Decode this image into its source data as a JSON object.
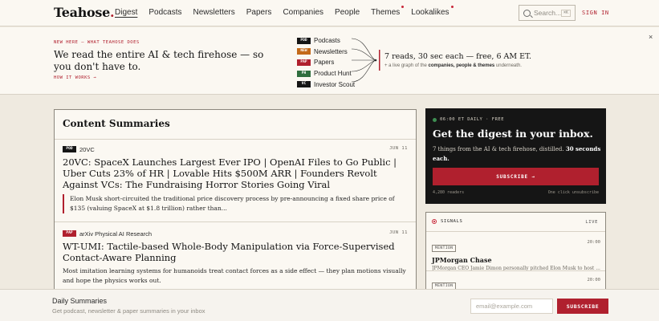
{
  "nav": {
    "logo": "Teahose",
    "logo_dot": ".",
    "links": [
      {
        "label": "Digest",
        "active": true,
        "dot": false
      },
      {
        "label": "Podcasts",
        "active": false,
        "dot": false
      },
      {
        "label": "Newsletters",
        "active": false,
        "dot": false
      },
      {
        "label": "Papers",
        "active": false,
        "dot": false
      },
      {
        "label": "Companies",
        "active": false,
        "dot": false
      },
      {
        "label": "People",
        "active": false,
        "dot": false
      },
      {
        "label": "Themes",
        "active": false,
        "dot": true
      },
      {
        "label": "Lookalikes",
        "active": false,
        "dot": true
      }
    ],
    "search_placeholder": "Search...",
    "search_shortcut": "⌘K",
    "signin": "SIGN IN"
  },
  "banner": {
    "kicker": "NEW HERE — WHAT TEAHOSE DOES",
    "headline": "We read the entire AI & tech firehose — so you don't have to.",
    "how_link": "HOW IT WORKS →",
    "sources": [
      {
        "badge": "POD",
        "label": "Podcasts",
        "color": "#151515"
      },
      {
        "badge": "NEW",
        "label": "Newsletters",
        "color": "#c46a1a"
      },
      {
        "badge": "PAP",
        "label": "Papers",
        "color": "#b0202e"
      },
      {
        "badge": "PH",
        "label": "Product Hunt",
        "color": "#2f6e3e"
      },
      {
        "badge": "VC",
        "label": "Investor Scout",
        "color": "#151515"
      }
    ],
    "tagline": "7 reads, 30 sec each — free, 6 AM ET.",
    "sub_prefix": "+ a live graph of the ",
    "sub_bold": "companies, people & themes",
    "sub_suffix": " underneath.",
    "close": "×"
  },
  "summaries": {
    "title": "Content Summaries",
    "items": [
      {
        "badge": "POD",
        "badge_color": "#151515",
        "source": "20VC",
        "date": "JUN 11",
        "title": "20VC: SpaceX Launches Largest Ever IPO | OpenAI Files to Go Public | Uber Cuts 23% of HR | Lovable Hits $500M ARR | Founders Revolt Against VCs: The Fundraising Horror Stories Going Viral",
        "quote": "Elon Musk short-circuited the traditional price discovery process by pre-announcing a fixed share price of $135 (valuing SpaceX at $1.8 trillion) rather than..."
      },
      {
        "badge": "PAP",
        "badge_color": "#b0202e",
        "source": "arXiv Physical AI Research",
        "date": "JUN 11",
        "title": "WT-UMI: Tactile-based Whole-Body Manipulation via Force-Supervised Contact-Aware Planning",
        "excerpt": "Most imitation learning systems for humanoids treat contact forces as a side effect — they plan motions visually and hope the physics works out."
      }
    ]
  },
  "digest": {
    "kicker": "06:00 ET DAILY · FREE",
    "title": "Get the digest in your inbox.",
    "body_prefix": "7 things from the AI & tech firehose, distilled. ",
    "body_bold": "30 seconds each.",
    "button": "SUBSCRIBE →",
    "readers": "4,280 readers",
    "unsub": "One click unsubscribe"
  },
  "signals": {
    "title": "SIGNALS",
    "live": "LIVE",
    "items": [
      {
        "tag": "MENTION",
        "time": "20:00",
        "title": "JPMorgan Chase",
        "text": "JPMorgan CEO Jamie Dimon personally pitched Elon Musk to host ..."
      },
      {
        "tag": "MENTION",
        "time": "20:00",
        "title": "",
        "text": ""
      }
    ]
  },
  "footer": {
    "title": "Daily Summaries",
    "subtitle": "Get podcast, newsletter & paper summaries in your inbox",
    "email_placeholder": "email@example.com",
    "button": "SUBSCRIBE"
  }
}
